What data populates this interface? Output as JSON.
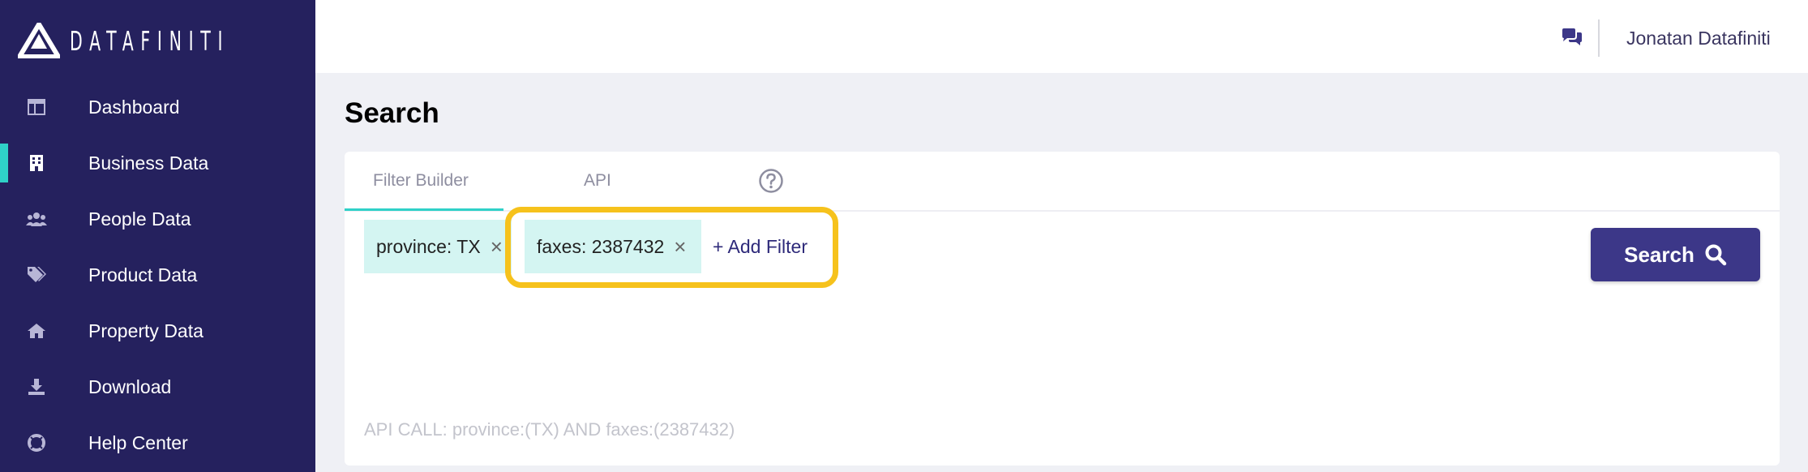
{
  "brand": {
    "name": "DATAFINITI",
    "logo_icon": "datafiniti-logo-icon"
  },
  "sidebar": {
    "items": [
      {
        "label": "Dashboard",
        "icon": "dashboard-icon",
        "active": false
      },
      {
        "label": "Business Data",
        "icon": "building-icon",
        "active": true
      },
      {
        "label": "People Data",
        "icon": "users-icon",
        "active": false
      },
      {
        "label": "Product Data",
        "icon": "tags-icon",
        "active": false
      },
      {
        "label": "Property Data",
        "icon": "home-icon",
        "active": false
      },
      {
        "label": "Download",
        "icon": "download-icon",
        "active": false
      },
      {
        "label": "Help Center",
        "icon": "life-ring-icon",
        "active": false
      }
    ]
  },
  "header": {
    "user_name": "Jonatan Datafiniti",
    "chat_icon": "chat-icon"
  },
  "main": {
    "title": "Search",
    "tabs": [
      {
        "label": "Filter Builder",
        "active": true
      },
      {
        "label": "API",
        "active": false
      }
    ],
    "filters": [
      {
        "label": "province: TX"
      },
      {
        "label": "faxes: 2387432"
      }
    ],
    "add_filter_label": "+ Add Filter",
    "search_button_label": "Search",
    "api_call": "API CALL: province:(TX) AND faxes:(2387432)"
  },
  "colors": {
    "sidebar_bg": "#25215e",
    "accent": "#2fd1c8",
    "chip_bg": "#d4f5f2",
    "button_bg": "#3c3788",
    "highlight": "#f6c21c"
  }
}
